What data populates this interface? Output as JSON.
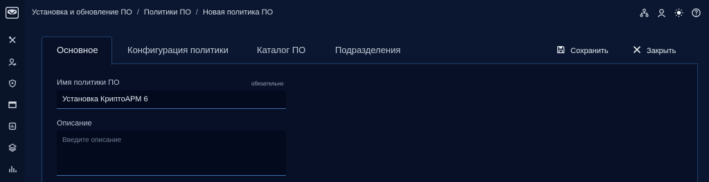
{
  "breadcrumb": {
    "items": [
      "Установка и обновление ПО",
      "Политики ПО",
      "Новая политика ПО"
    ],
    "separator": "/"
  },
  "topbar_icons": [
    "org-structure-icon",
    "user-icon",
    "sun-icon",
    "help-icon"
  ],
  "sidebar": {
    "icons": [
      "tools-icon",
      "user-settings-icon",
      "shield-icon",
      "window-icon",
      "report-icon",
      "layers-icon",
      "chart-icon"
    ]
  },
  "tabs": [
    {
      "label": "Основное",
      "active": true
    },
    {
      "label": "Конфигурация политики",
      "active": false
    },
    {
      "label": "Каталог ПО",
      "active": false
    },
    {
      "label": "Подразделения",
      "active": false
    }
  ],
  "actions": {
    "save_label": "Сохранить",
    "close_label": "Закрыть"
  },
  "form": {
    "name_label": "Имя политики ПО",
    "required_label": "обязательно",
    "name_value": "Установка КриптоАРМ  6",
    "description_label": "Описание",
    "description_placeholder": "Введите описание"
  },
  "colors": {
    "background": "#0b1730",
    "panel": "#071026",
    "border": "#1f3e6b",
    "input_underline": "#3f6ea8"
  }
}
